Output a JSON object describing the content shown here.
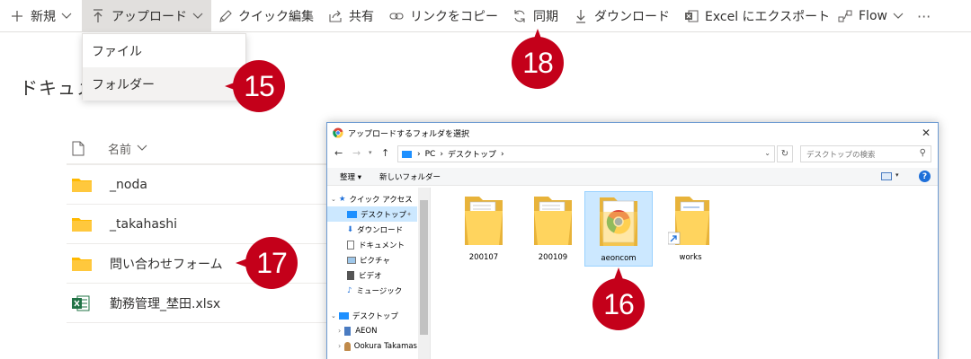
{
  "command_bar": {
    "new_label": "新規",
    "upload_label": "アップロード",
    "quick_edit_label": "クイック編集",
    "share_label": "共有",
    "copy_link_label": "リンクをコピー",
    "sync_label": "同期",
    "download_label": "ダウンロード",
    "export_excel_label": "Excel にエクスポート",
    "flow_label": "Flow",
    "more_label": "···"
  },
  "upload_menu": {
    "items": [
      {
        "label": "ファイル"
      },
      {
        "label": "フォルダー"
      }
    ]
  },
  "library": {
    "title": "ドキュメ",
    "name_column": "名前",
    "items": [
      {
        "name": "_noda",
        "type": "folder"
      },
      {
        "name": "_takahashi",
        "type": "folder"
      },
      {
        "name": "問い合わせフォーム",
        "type": "folder"
      },
      {
        "name": "勤務管理_埜田.xlsx",
        "type": "excel"
      }
    ]
  },
  "badges": {
    "b15": "15",
    "b16": "16",
    "b17": "17",
    "b18": "18"
  },
  "dialog": {
    "title": "アップロードするフォルダを選択",
    "address": {
      "segments": [
        "PC",
        "デスクトップ"
      ]
    },
    "search_placeholder": "デスクトップの検索",
    "toolbar": {
      "organize_label": "整理 ▾",
      "new_folder_label": "新しいフォルダー"
    },
    "nav": {
      "quick_access": "クイック アクセス",
      "desktop": "デスクトップ",
      "downloads": "ダウンロード",
      "documents": "ドキュメント",
      "pictures": "ピクチャ",
      "videos": "ビデオ",
      "music": "ミュージック",
      "desktop_root": "デスクトップ",
      "aeon": "AEON",
      "user": "Ookura Takamas"
    },
    "folders": [
      {
        "name": "200107"
      },
      {
        "name": "200109"
      },
      {
        "name": "aeoncom"
      },
      {
        "name": "works"
      }
    ]
  },
  "colors": {
    "badge": "#c4001a",
    "folder": "#ffb900",
    "excel": "#217346",
    "selection": "#cce8ff"
  }
}
